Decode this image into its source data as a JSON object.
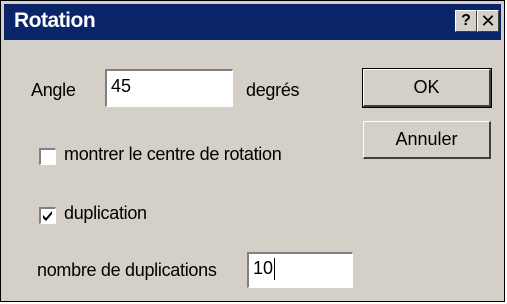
{
  "window": {
    "title": "Rotation",
    "help_label": "?",
    "close_label": "✕"
  },
  "angle": {
    "label": "Angle",
    "value": "45",
    "unit": "degrés"
  },
  "buttons": {
    "ok_label": "OK",
    "cancel_label": "Annuler"
  },
  "show_center": {
    "label": "montrer le centre de rotation",
    "checked": false
  },
  "duplication": {
    "label": "duplication",
    "checked": true
  },
  "duplicates": {
    "label": "nombre de duplications",
    "value": "10"
  }
}
